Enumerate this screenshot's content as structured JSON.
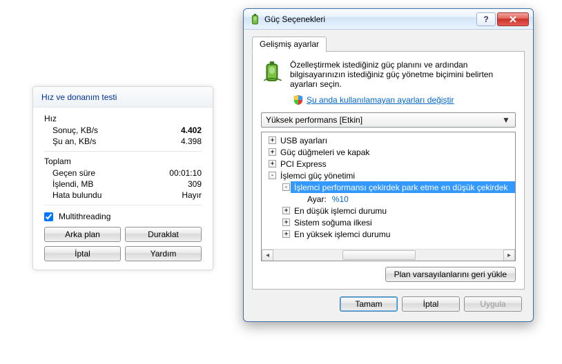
{
  "leftPanel": {
    "title": "Hız ve donanım testi",
    "speed": {
      "header": "Hız",
      "result_label": "Sonuç, KB/s",
      "result_value": "4.402",
      "now_label": "Şu an, KB/s",
      "now_value": "4.398"
    },
    "total": {
      "header": "Toplam",
      "elapsed_label": "Geçen süre",
      "elapsed_value": "00:01:10",
      "processed_label": "İşlendi, MB",
      "processed_value": "309",
      "errors_label": "Hata bulundu",
      "errors_value": "Hayır"
    },
    "multithreading_label": "Multithreading",
    "buttons": {
      "background": "Arka plan",
      "pause": "Duraklat",
      "cancel": "İptal",
      "help": "Yardım"
    }
  },
  "dialog": {
    "title": "Güç Seçenekleri",
    "tab": "Gelişmiş ayarlar",
    "description": "Özelleştirmek istediğiniz güç planını ve ardından bilgisayarınızın istediğiniz güç yönetme biçimini belirten ayarları seçin.",
    "link": "Şu anda kullanılamayan ayarları değiştir",
    "plan": "Yüksek performans [Etkin]",
    "tree": {
      "usb": "USB ayarları",
      "power_buttons": "Güç düğmeleri ve kapak",
      "pci": "PCI Express",
      "cpu": "İşlemci güç yönetimi",
      "core_parking": "İşlemci performansı çekirdek park etme en düşük çekirdek",
      "setting_label": "Ayar:",
      "setting_value": "%10",
      "min_state": "En düşük işlemci durumu",
      "cooling": "Sistem soğuma ilkesi",
      "max_state": "En yüksek işlemci durumu"
    },
    "restore_defaults": "Plan varsayılanlarını geri yükle",
    "ok": "Tamam",
    "cancel": "İptal",
    "apply": "Uygula"
  }
}
